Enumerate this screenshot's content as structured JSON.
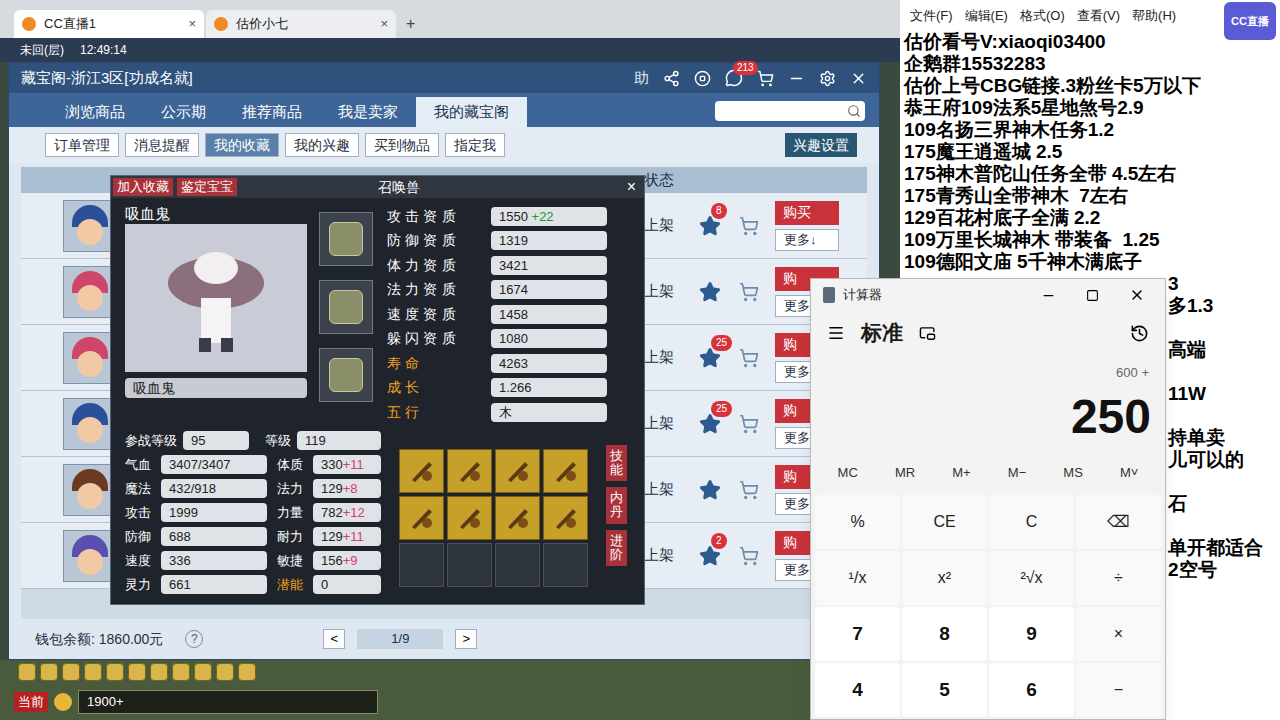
{
  "logo": "CC直播",
  "browser": {
    "tabs": [
      {
        "label": "CC直播1",
        "selected": true,
        "close": "×"
      },
      {
        "label": "估价小七",
        "selected": false,
        "close": "×"
      }
    ],
    "new_tab": "+"
  },
  "game": {
    "status": [
      "未回(层)",
      "12:49:14"
    ],
    "chat_channel": "当前",
    "input": "1900+"
  },
  "cbg": {
    "title": "藏宝阁-浙江3区[功成名就]",
    "help": "助",
    "message_badge": "213",
    "nav": [
      {
        "label": "浏览商品",
        "selected": false
      },
      {
        "label": "公示期",
        "selected": false
      },
      {
        "label": "推荐商品",
        "selected": false
      },
      {
        "label": "我是卖家",
        "selected": false
      },
      {
        "label": "我的藏宝阁",
        "selected": true
      }
    ],
    "subnav": [
      {
        "label": "订单管理",
        "selected": false
      },
      {
        "label": "消息提醒",
        "selected": false
      },
      {
        "label": "我的收藏",
        "selected": true
      },
      {
        "label": "我的兴趣",
        "selected": false
      },
      {
        "label": "买到物品",
        "selected": false
      },
      {
        "label": "指定我",
        "selected": false
      }
    ],
    "interest_button": "兴趣设置",
    "column": "状态",
    "rows": [
      {
        "status": "上架",
        "badge": "8",
        "buy": "购买",
        "more": "更多↓",
        "avatar_color": "#2b4f9a"
      },
      {
        "status": "上架",
        "badge": "",
        "buy": "购",
        "more": "更多",
        "avatar_color": "#d0456a"
      },
      {
        "status": "上架",
        "badge": "25",
        "buy": "购",
        "more": "更多",
        "avatar_color": "#d0456a"
      },
      {
        "status": "上架",
        "badge": "25",
        "buy": "购",
        "more": "更多",
        "avatar_color": "#2b4f9a"
      },
      {
        "status": "上架",
        "badge": "",
        "buy": "购",
        "more": "更多",
        "avatar_color": "#6b3a22"
      },
      {
        "status": "上架",
        "badge": "2",
        "buy": "购",
        "more": "更多",
        "avatar_color": "#5a4fb0"
      }
    ],
    "wallet": "钱包余额: 1860.00元",
    "help_mark": "?",
    "pager": {
      "prev": "<",
      "page": "1/9",
      "next": ">"
    }
  },
  "pet": {
    "actions": [
      "加入收藏",
      "鉴定宝宝"
    ],
    "title": "召唤兽",
    "close": "×",
    "name": "吸血鬼",
    "label": "吸血鬼",
    "equipment": [
      {
        "filled": true
      },
      {
        "filled": true
      },
      {
        "filled": true
      }
    ],
    "aptitudes": [
      {
        "label": "攻击资质",
        "value": "1550",
        "bonus": "+22",
        "highlight": false
      },
      {
        "label": "防御资质",
        "value": "1319",
        "bonus": "",
        "highlight": false
      },
      {
        "label": "体力资质",
        "value": "3421",
        "bonus": "",
        "highlight": false
      },
      {
        "label": "法力资质",
        "value": "1674",
        "bonus": "",
        "highlight": false
      },
      {
        "label": "速度资质",
        "value": "1458",
        "bonus": "",
        "highlight": false
      },
      {
        "label": "躲闪资质",
        "value": "1080",
        "bonus": "",
        "highlight": false
      },
      {
        "label": "寿命",
        "value": "4263",
        "bonus": "",
        "highlight": true
      },
      {
        "label": "成长",
        "value": "1.266",
        "bonus": "",
        "highlight": true
      },
      {
        "label": "五行",
        "value": "木",
        "bonus": "",
        "highlight": true
      }
    ],
    "battle_level": {
      "label": "参战等级",
      "value": "95"
    },
    "level": {
      "label": "等级",
      "value": "119"
    },
    "stats": [
      {
        "label": "气血",
        "value": "3407/3407",
        "attr": "体质",
        "attr_value": "330",
        "bonus": "+11",
        "attr_highlight": false
      },
      {
        "label": "魔法",
        "value": "432/918",
        "attr": "法力",
        "attr_value": "129",
        "bonus": "+8",
        "attr_highlight": false
      },
      {
        "label": "攻击",
        "value": "1999",
        "attr": "力量",
        "attr_value": "782",
        "bonus": "+12",
        "attr_highlight": false
      },
      {
        "label": "防御",
        "value": "688",
        "attr": "耐力",
        "attr_value": "129",
        "bonus": "+11",
        "attr_highlight": false
      },
      {
        "label": "速度",
        "value": "336",
        "attr": "敏捷",
        "attr_value": "156",
        "bonus": "+9",
        "attr_highlight": false
      },
      {
        "label": "灵力",
        "value": "661",
        "attr": "潜能",
        "attr_value": "0",
        "bonus": "",
        "attr_highlight": true
      }
    ],
    "skills": [
      {
        "filled": true
      },
      {
        "filled": true
      },
      {
        "filled": true
      },
      {
        "filled": true
      },
      {
        "filled": true
      },
      {
        "filled": true
      },
      {
        "filled": true
      },
      {
        "filled": true
      },
      {
        "filled": false
      },
      {
        "filled": false
      },
      {
        "filled": false
      },
      {
        "filled": false
      }
    ],
    "side_buttons": [
      "技能",
      "内丹",
      "进阶"
    ]
  },
  "notepad": {
    "menu": [
      "文件(F)",
      "编辑(E)",
      "格式(O)",
      "查看(V)",
      "帮助(H)"
    ],
    "lines": [
      "估价看号V:xiaoqi03400",
      "企鹅群15532283",
      "估价上号CBG链接.3粉丝卡5万以下",
      "恭王府109法系5星地煞号2.9",
      "109名扬三界神木任务1.2",
      "175魔王逍遥城 2.5",
      "175神木普陀山任务全带 4.5左右",
      "175青秀山全带神木  7左右",
      "129百花村底子全满 2.2",
      "109万里长城神木 带装备  1.25",
      "109德阳文庙 5千神木满底子"
    ],
    "lines_beside_calculator": [
      "3",
      "多1.3",
      "",
      "高端",
      "",
      "11W",
      "",
      "持单卖",
      "儿可以的",
      "",
      "石",
      "",
      "单开都适合",
      "2空号"
    ]
  },
  "calculator": {
    "title": "计算器",
    "mode": "标准",
    "expression": "600 +",
    "display": "250",
    "memory": [
      "MC",
      "MR",
      "M+",
      "M−",
      "MS",
      "M˅"
    ],
    "keys": [
      {
        "label": "%",
        "kind": "op"
      },
      {
        "label": "CE",
        "kind": "op"
      },
      {
        "label": "C",
        "kind": "op"
      },
      {
        "label": "⌫",
        "kind": "op"
      },
      {
        "label": "¹/x",
        "kind": "op"
      },
      {
        "label": "x²",
        "kind": "op"
      },
      {
        "label": "²√x",
        "kind": "op"
      },
      {
        "label": "÷",
        "kind": "op"
      },
      {
        "label": "7",
        "kind": "digit"
      },
      {
        "label": "8",
        "kind": "digit"
      },
      {
        "label": "9",
        "kind": "digit"
      },
      {
        "label": "×",
        "kind": "op"
      },
      {
        "label": "4",
        "kind": "digit"
      },
      {
        "label": "5",
        "kind": "digit"
      },
      {
        "label": "6",
        "kind": "digit"
      },
      {
        "label": "−",
        "kind": "op"
      }
    ]
  }
}
